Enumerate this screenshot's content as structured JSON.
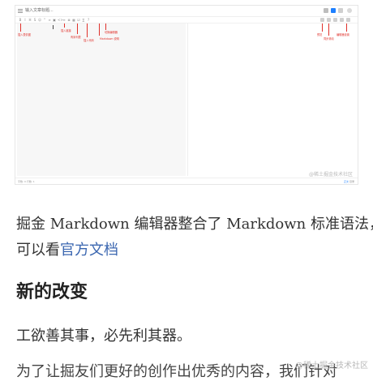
{
  "editor": {
    "title_placeholder": "输入文章标题...",
    "saved_status": "",
    "annotations": {
      "insert_emoji": "插入表情图",
      "insert_link": "插入链接",
      "numbered_list": "有序列表",
      "insert_code": "插入代码",
      "markdown_guide": "Markdown 说明",
      "quick_switch": "切换编辑器",
      "preview": "预览",
      "sync_scroll": "同步滚动",
      "editor_settings": "编辑器设置"
    },
    "footer_left": "字数: 0  行数: 1",
    "footer_right_a": "正文",
    "footer_right_b": "目录",
    "watermark": "@稀土掘金技术社区"
  },
  "article": {
    "p1": "掘金 Markdown 编辑器整合了 Markdown 标准语法，",
    "p2_prefix": "可以看",
    "p2_link": "官方文档",
    "heading": "新的改变",
    "p3": "工欲善其事，必先利其器。",
    "p4": "为了让掘友们更好的创作出优秀的内容，我们针对",
    "watermark": "@稀土掘金技术社区"
  },
  "colors": {
    "annotation": "#e0312b",
    "link": "#3a66b0",
    "accent": "#1e80ff"
  }
}
